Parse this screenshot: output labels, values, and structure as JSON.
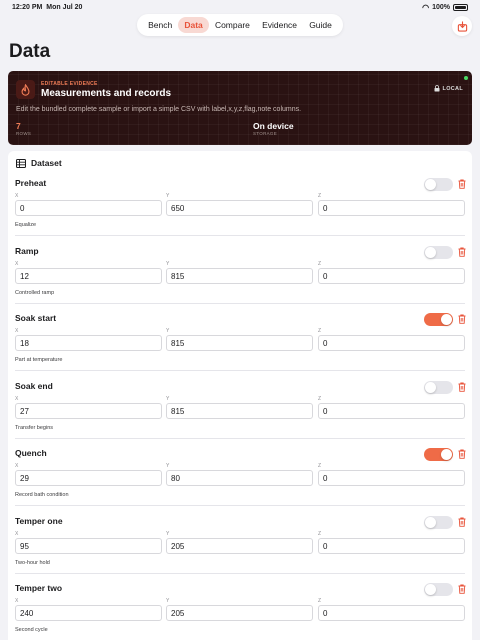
{
  "status": {
    "time": "12:20 PM",
    "date": "Mon Jul 20",
    "battery": "100%"
  },
  "tabs": [
    {
      "label": "Bench"
    },
    {
      "label": "Data",
      "active": true
    },
    {
      "label": "Compare"
    },
    {
      "label": "Evidence"
    },
    {
      "label": "Guide"
    }
  ],
  "page_title": "Data",
  "hero": {
    "kicker": "EDITABLE EVIDENCE",
    "title": "Measurements and records",
    "badge": "LOCAL",
    "description": "Edit the bundled complete sample or import a simple CSV with label,x,y,z,flag,note columns.",
    "rows_value": "7",
    "rows_label": "ROWS",
    "storage_value": "On device",
    "storage_label": "STORAGE"
  },
  "dataset": {
    "title": "Dataset",
    "x_label": "X",
    "y_label": "Y",
    "z_label": "Z",
    "rows": [
      {
        "name": "Preheat",
        "flag": false,
        "x": "0",
        "y": "650",
        "z": "0",
        "note": "Equalize"
      },
      {
        "name": "Ramp",
        "flag": false,
        "x": "12",
        "y": "815",
        "z": "0",
        "note": "Controlled ramp"
      },
      {
        "name": "Soak start",
        "flag": true,
        "x": "18",
        "y": "815",
        "z": "0",
        "note": "Part at temperature"
      },
      {
        "name": "Soak end",
        "flag": false,
        "x": "27",
        "y": "815",
        "z": "0",
        "note": "Transfer begins"
      },
      {
        "name": "Quench",
        "flag": true,
        "x": "29",
        "y": "80",
        "z": "0",
        "note": "Record bath condition"
      },
      {
        "name": "Temper one",
        "flag": false,
        "x": "95",
        "y": "205",
        "z": "0",
        "note": "Two-hour hold"
      },
      {
        "name": "Temper two",
        "flag": false,
        "x": "240",
        "y": "205",
        "z": "0",
        "note": "Second cycle"
      }
    ]
  },
  "colors": {
    "accent": "#ef6b47",
    "hero_bg": "#2a1212",
    "page_bg": "#f2f2f6"
  }
}
